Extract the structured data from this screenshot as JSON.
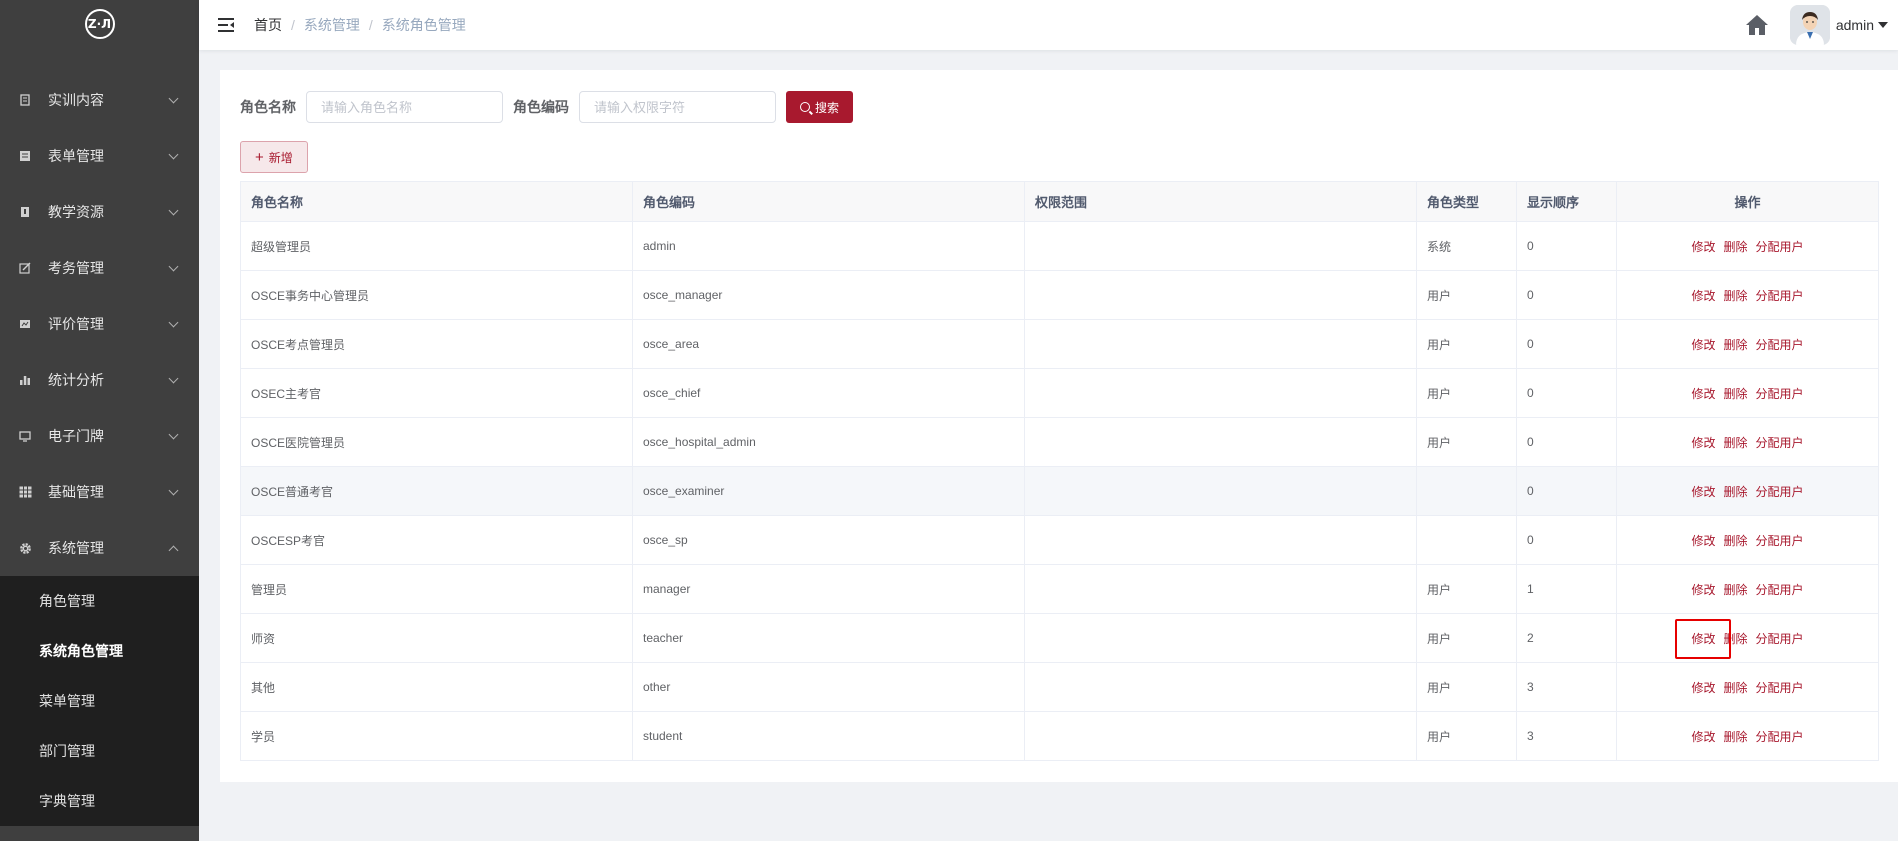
{
  "sidebar": {
    "logo_text": "Z·Л",
    "menu": [
      {
        "label": "实训内容",
        "icon": "clipboard-icon",
        "expanded": false
      },
      {
        "label": "表单管理",
        "icon": "form-icon",
        "expanded": false
      },
      {
        "label": "教学资源",
        "icon": "book-icon",
        "expanded": false
      },
      {
        "label": "考务管理",
        "icon": "edit-icon",
        "expanded": false
      },
      {
        "label": "评价管理",
        "icon": "chart-card-icon",
        "expanded": false
      },
      {
        "label": "统计分析",
        "icon": "bar-chart-icon",
        "expanded": false
      },
      {
        "label": "电子门牌",
        "icon": "monitor-icon",
        "expanded": false
      },
      {
        "label": "基础管理",
        "icon": "grid-icon",
        "expanded": false
      },
      {
        "label": "系统管理",
        "icon": "gear-icon",
        "expanded": true
      }
    ],
    "submenu": [
      {
        "label": "角色管理",
        "active": false
      },
      {
        "label": "系统角色管理",
        "active": true
      },
      {
        "label": "菜单管理",
        "active": false
      },
      {
        "label": "部门管理",
        "active": false
      },
      {
        "label": "字典管理",
        "active": false
      }
    ]
  },
  "navbar": {
    "breadcrumb": [
      "首页",
      "系统管理",
      "系统角色管理"
    ],
    "username": "admin"
  },
  "search": {
    "role_name_label": "角色名称",
    "role_name_placeholder": "请输入角色名称",
    "role_code_label": "角色编码",
    "role_code_placeholder": "请输入权限字符",
    "search_button": "搜索",
    "add_button": "新增"
  },
  "table": {
    "columns": [
      "角色名称",
      "角色编码",
      "权限范围",
      "角色类型",
      "显示顺序",
      "操作"
    ],
    "actions": [
      "修改",
      "删除",
      "分配用户"
    ],
    "rows": [
      {
        "name": "超级管理员",
        "code": "admin",
        "scope": "",
        "type": "系统",
        "order": "0"
      },
      {
        "name": "OSCE事务中心管理员",
        "code": "osce_manager",
        "scope": "",
        "type": "用户",
        "order": "0"
      },
      {
        "name": "OSCE考点管理员",
        "code": "osce_area",
        "scope": "",
        "type": "用户",
        "order": "0"
      },
      {
        "name": "OSEC主考官",
        "code": "osce_chief",
        "scope": "",
        "type": "用户",
        "order": "0"
      },
      {
        "name": "OSCE医院管理员",
        "code": "osce_hospital_admin",
        "scope": "",
        "type": "用户",
        "order": "0"
      },
      {
        "name": "OSCE普通考官",
        "code": "osce_examiner",
        "scope": "",
        "type": "",
        "order": "0"
      },
      {
        "name": "OSCESP考官",
        "code": "osce_sp",
        "scope": "",
        "type": "",
        "order": "0"
      },
      {
        "name": "管理员",
        "code": "manager",
        "scope": "",
        "type": "用户",
        "order": "1"
      },
      {
        "name": "师资",
        "code": "teacher",
        "scope": "",
        "type": "用户",
        "order": "2"
      },
      {
        "name": "其他",
        "code": "other",
        "scope": "",
        "type": "用户",
        "order": "3"
      },
      {
        "name": "学员",
        "code": "student",
        "scope": "",
        "type": "用户",
        "order": "3"
      }
    ]
  },
  "colors": {
    "accent": "#a8192e",
    "sidebar_bg": "#3f3f3f",
    "submenu_bg": "#1f1f1f",
    "highlight_box": "#e60000"
  }
}
